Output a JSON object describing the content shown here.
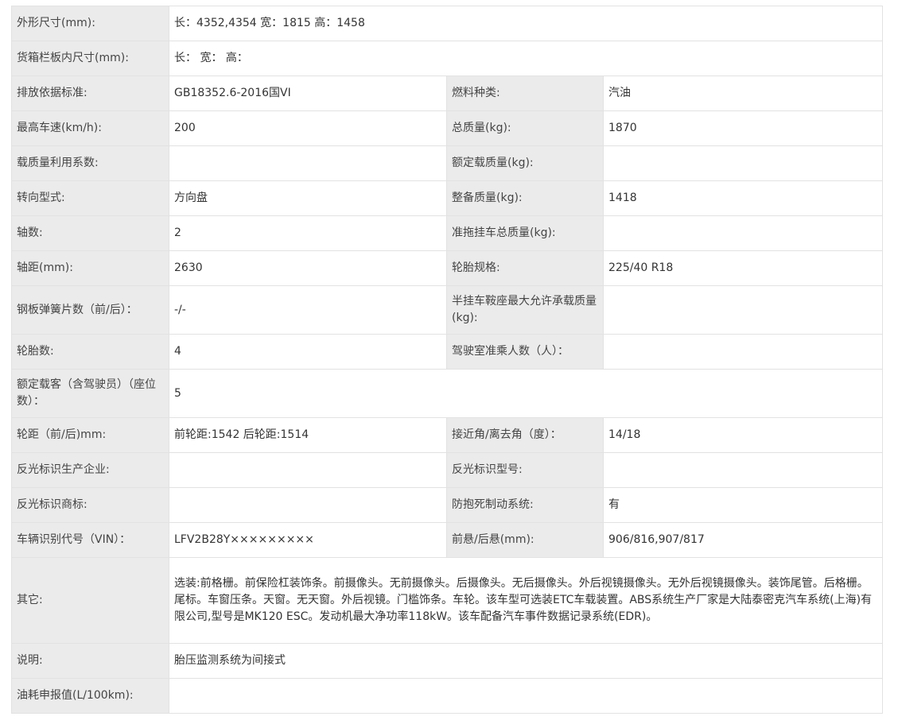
{
  "rows": [
    {
      "label": "外形尺寸(mm):",
      "value": "长：4352,4354 宽：1815 高：1458"
    },
    {
      "label": "货箱栏板内尺寸(mm):",
      "value": "长： 宽： 高："
    },
    {
      "label": "排放依据标准:",
      "value": "GB18352.6-2016国VI",
      "label2": "燃料种类:",
      "value2": "汽油"
    },
    {
      "label": "最高车速(km/h):",
      "value": "200",
      "label2": "总质量(kg):",
      "value2": "1870"
    },
    {
      "label": "载质量利用系数:",
      "value": "",
      "label2": "额定载质量(kg):",
      "value2": ""
    },
    {
      "label": "转向型式:",
      "value": "方向盘",
      "label2": "整备质量(kg):",
      "value2": "1418"
    },
    {
      "label": "轴数:",
      "value": "2",
      "label2": "准拖挂车总质量(kg):",
      "value2": ""
    },
    {
      "label": "轴距(mm):",
      "value": "2630",
      "label2": "轮胎规格:",
      "value2": "225/40 R18"
    },
    {
      "label": "钢板弹簧片数（前/后）：",
      "value": "-/-",
      "label2": "半挂车鞍座最大允许承载质量(kg):",
      "value2": ""
    },
    {
      "label": "轮胎数:",
      "value": "4",
      "label2": "驾驶室准乘人数（人）：",
      "value2": ""
    },
    {
      "label": "额定载客（含驾驶员）（座位数）：",
      "value": "5"
    },
    {
      "label": "轮距（前/后)mm:",
      "value": "前轮距:1542 后轮距:1514",
      "label2": "接近角/离去角（度）：",
      "value2": "14/18"
    },
    {
      "label": "反光标识生产企业:",
      "value": "",
      "label2": "反光标识型号:",
      "value2": ""
    },
    {
      "label": "反光标识商标:",
      "value": "",
      "label2": "防抱死制动系统:",
      "value2": "有"
    },
    {
      "label": "车辆识别代号（VIN）：",
      "value": "LFV2B28Y×××××××××",
      "label2": "前悬/后悬(mm):",
      "value2": "906/816,907/817"
    },
    {
      "label": "其它:",
      "value": "选装:前格栅。前保险杠装饰条。前摄像头。无前摄像头。后摄像头。无后摄像头。外后视镜摄像头。无外后视镜摄像头。装饰尾管。后格栅。尾标。车窗压条。天窗。无天窗。外后视镜。门槛饰条。车轮。该车型可选装ETC车载装置。ABS系统生产厂家是大陆泰密克汽车系统(上海)有限公司,型号是MK120 ESC。发动机最大净功率118kW。该车配备汽车事件数据记录系统(EDR)。"
    },
    {
      "label": "说明:",
      "value": "胎压监测系统为间接式"
    },
    {
      "label": "油耗申报值(L/100km):",
      "value": ""
    }
  ]
}
